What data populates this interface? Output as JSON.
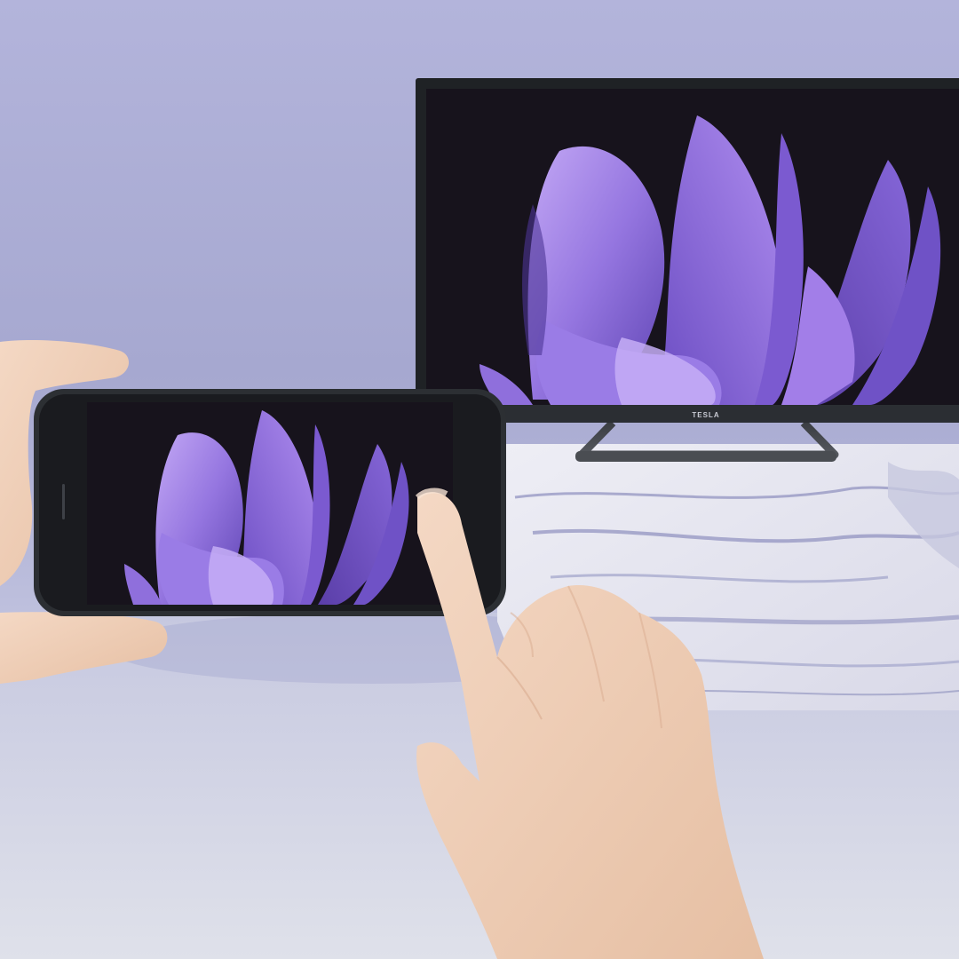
{
  "scene": {
    "description_free": true,
    "tv": {
      "brand_logo_text": "TESLA"
    },
    "colors": {
      "wall_top": "#a9abd1",
      "wall_bottom": "#c4c6e3",
      "floor": "#d9dce7",
      "tv_bezel": "#1f2225",
      "screen_bg": "#17131c",
      "petal_light": "#b79bf0",
      "petal_mid": "#8f6fdc",
      "petal_dark": "#5b3fb0",
      "marble": "#e4e4ee",
      "skin": "#efcdb4"
    },
    "icons": [
      "tv",
      "smartphone",
      "flower-wallpaper",
      "hand"
    ]
  }
}
